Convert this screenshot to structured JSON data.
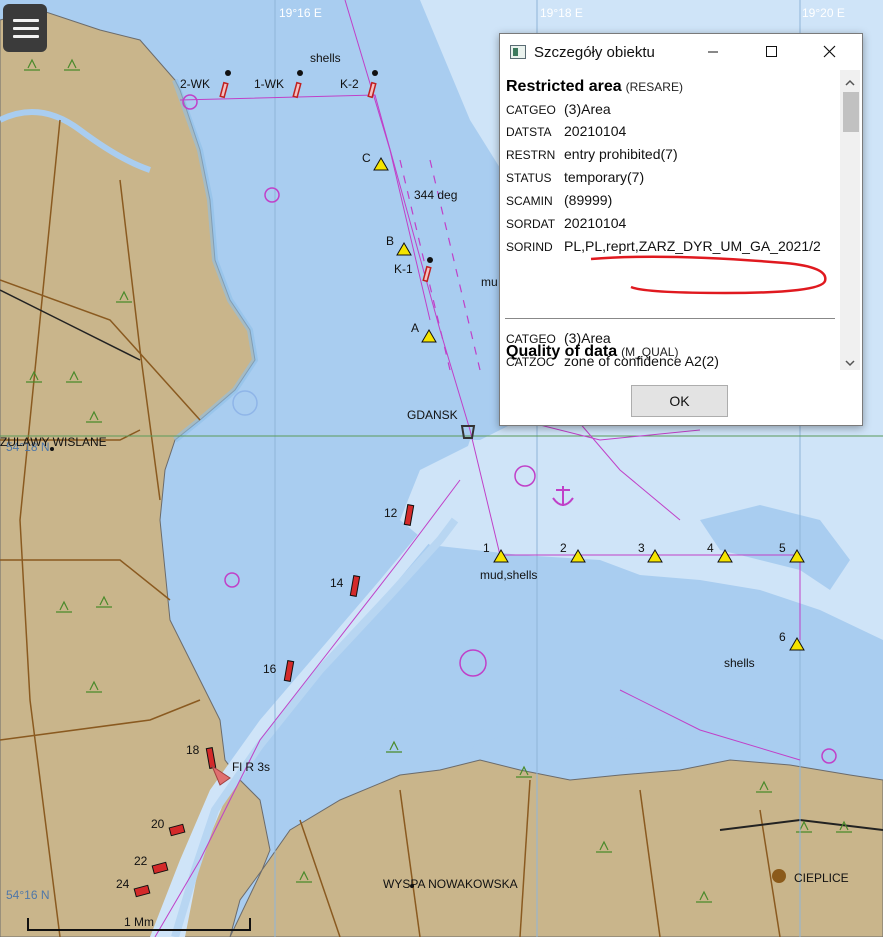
{
  "map": {
    "labels": {
      "coord_top_left": "19°16 E",
      "coord_top_mid": "19°18 E",
      "coord_top_right": "19°20 E",
      "lat_top": "54°18 N",
      "lat_bottom": "54°16 N",
      "zulawy": "ZULAWY WISLANE",
      "gdansk": "GDANSK",
      "wyspa": "WYSPA NOWAKOWSKA",
      "cieplice": "CIEPLICE",
      "shells_top": "shells",
      "shells_right": "shells",
      "mud_shells": "mud,shells",
      "mud_partial": "mu",
      "heading": "344 deg",
      "light": "Fl R 3s",
      "scale": "1 Mm",
      "b_2wk": "2-WK",
      "b_1wk": "1-WK",
      "b_k2": "K-2",
      "b_k1": "K-1",
      "b_c": "C",
      "b_b": "B",
      "b_a": "A",
      "n1": "1",
      "n2": "2",
      "n3": "3",
      "n4": "4",
      "n5": "5",
      "n6": "6",
      "n12": "12",
      "n14": "14",
      "n16": "16",
      "n18": "18",
      "n20": "20",
      "n22": "22",
      "n24": "24"
    },
    "colors": {
      "land": "#c9b58b",
      "deep_water": "#a9cdf0",
      "shallow_water": "#cfe4f8",
      "magenta": "#c040c8",
      "buoy_yellow": "#f5e400",
      "buoy_red": "#d42a2a"
    }
  },
  "menu": {
    "icon": "hamburger-menu-icon"
  },
  "dialog": {
    "title": "Szczegóły obiektu",
    "sections": [
      {
        "name": "Restricted area",
        "acronym": "(RESARE)",
        "rows": [
          {
            "key": "CATGEO",
            "value": "(3)Area"
          },
          {
            "key": "DATSTA",
            "value": "20210104"
          },
          {
            "key": "RESTRN",
            "value": "entry prohibited(7)"
          },
          {
            "key": "STATUS",
            "value": "temporary(7)"
          },
          {
            "key": "SCAMIN",
            "value": "(89999)"
          },
          {
            "key": "SORDAT",
            "value": "20210104"
          },
          {
            "key": "SORIND",
            "value": "PL,PL,reprt,ZARZ_DYR_UM_GA_2021/2"
          }
        ]
      },
      {
        "name": "Quality of data",
        "acronym": "(M_QUAL)",
        "rows": [
          {
            "key": "CATGEO",
            "value": "(3)Area"
          },
          {
            "key": "CATZOC",
            "value": "zone of confidence A2(2)"
          }
        ]
      }
    ],
    "ok_label": "OK"
  }
}
